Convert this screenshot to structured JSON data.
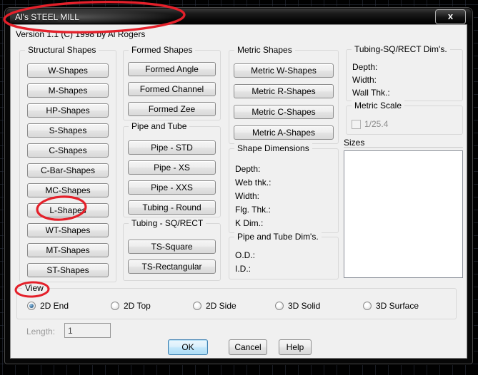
{
  "window": {
    "title": "Al's STEEL MILL",
    "close_glyph": "x",
    "version_line": "Version 1.1 (C) 1998 by Al Rogers"
  },
  "structural": {
    "title": "Structural Shapes",
    "buttons": [
      "W-Shapes",
      "M-Shapes",
      "HP-Shapes",
      "S-Shapes",
      "C-Shapes",
      "C-Bar-Shapes",
      "MC-Shapes",
      "L-Shapes",
      "WT-Shapes",
      "MT-Shapes",
      "ST-Shapes"
    ]
  },
  "formed": {
    "title": "Formed Shapes",
    "buttons": [
      "Formed Angle",
      "Formed Channel",
      "Formed Zee"
    ]
  },
  "pipe_tube": {
    "title": "Pipe and Tube",
    "buttons": [
      "Pipe - STD",
      "Pipe - XS",
      "Pipe - XXS",
      "Tubing - Round"
    ]
  },
  "tubing_sq": {
    "title": "Tubing - SQ/RECT",
    "buttons": [
      "TS-Square",
      "TS-Rectangular"
    ]
  },
  "metric": {
    "title": "Metric Shapes",
    "buttons": [
      "Metric W-Shapes",
      "Metric R-Shapes",
      "Metric C-Shapes",
      "Metric A-Shapes"
    ]
  },
  "shape_dims": {
    "title": "Shape Dimensions",
    "labels": [
      "Depth:",
      "Web thk.:",
      "Width:",
      "Flg. Thk.:",
      "K Dim.:"
    ]
  },
  "pipe_dims": {
    "title": "Pipe and Tube Dim's.",
    "labels": [
      "O.D.:",
      "I.D.:"
    ]
  },
  "tubing_dims": {
    "title": "Tubing-SQ/RECT Dim's.",
    "labels": [
      "Depth:",
      "Width:",
      "Wall Thk.:"
    ]
  },
  "metric_scale": {
    "title": "Metric Scale",
    "checkbox_label": "1/25.4",
    "checked": false
  },
  "sizes": {
    "label": "Sizes",
    "items": []
  },
  "view": {
    "title": "View",
    "options": [
      {
        "label": "2D End",
        "selected": true
      },
      {
        "label": "2D Top",
        "selected": false
      },
      {
        "label": "2D Side",
        "selected": false
      },
      {
        "label": "3D Solid",
        "selected": false
      },
      {
        "label": "3D Surface",
        "selected": false
      }
    ]
  },
  "length": {
    "label": "Length:",
    "value": "1"
  },
  "footer": {
    "ok": "OK",
    "cancel": "Cancel",
    "help": "Help"
  },
  "annotations": {
    "color": "#e4202a",
    "circled": [
      "Al's STEEL MILL",
      "L-Shapes",
      "View"
    ]
  }
}
